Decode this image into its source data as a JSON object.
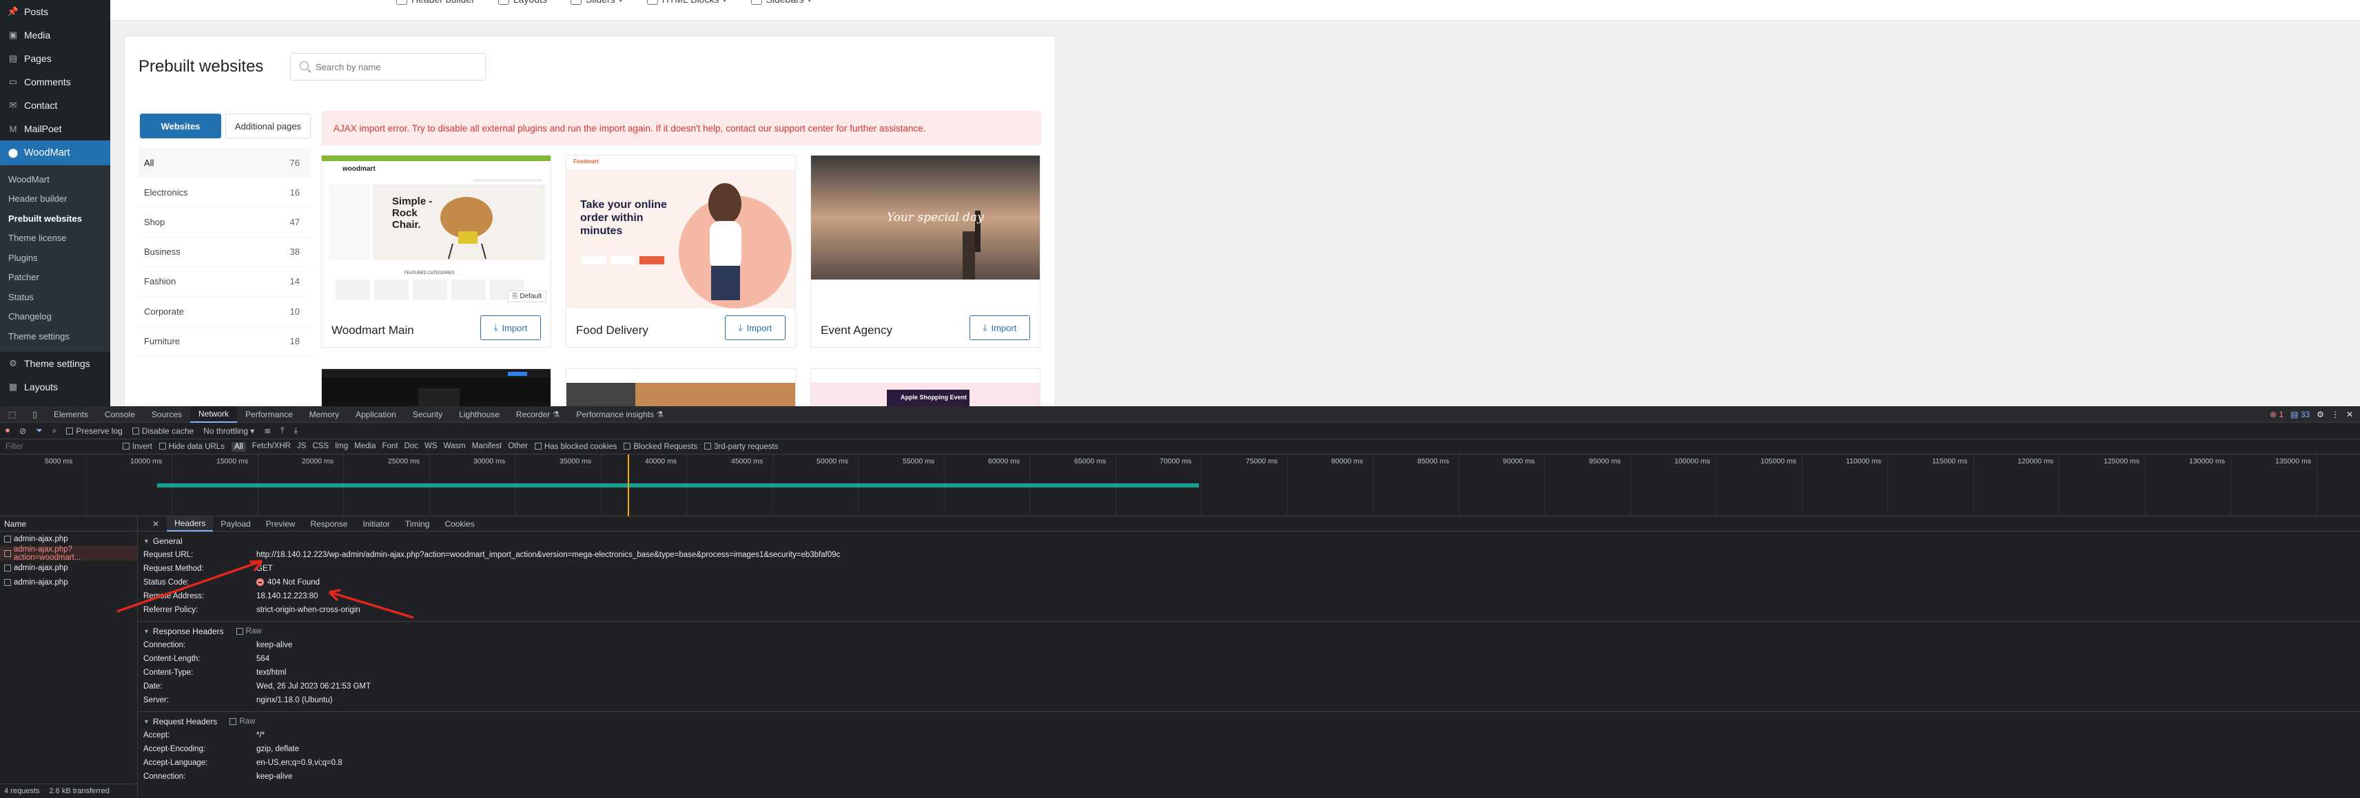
{
  "wp_sidebar": {
    "items_before": [
      {
        "label": "Posts",
        "icon": "pin-icon"
      },
      {
        "label": "Media",
        "icon": "media-icon"
      },
      {
        "label": "Pages",
        "icon": "pages-icon"
      },
      {
        "label": "Comments",
        "icon": "comments-icon"
      },
      {
        "label": "Contact",
        "icon": "mail-icon"
      },
      {
        "label": "MailPoet",
        "icon": "mailpoet-icon"
      }
    ],
    "current": "WoodMart",
    "subitems": [
      "WoodMart",
      "Header builder",
      "Prebuilt websites",
      "Theme license",
      "Plugins",
      "Patcher",
      "Status",
      "Changelog",
      "Theme settings"
    ],
    "items_after": [
      {
        "label": "Theme settings",
        "icon": "settings-icon"
      },
      {
        "label": "Layouts",
        "icon": "layouts-icon"
      }
    ]
  },
  "top_nav": [
    "Header builder",
    "Layouts",
    "Sliders ˅",
    "HTML Blocks ˅",
    "Sidebars ˅"
  ],
  "panel": {
    "title": "Prebuilt websites",
    "search_placeholder": "Search by name",
    "tab_websites": "Websites",
    "tab_additional": "Additional pages",
    "error": "AJAX import error. Try to disable all external plugins and run the import again. If it doesn't help, contact our support center for further assistance.",
    "categories": [
      {
        "name": "All",
        "count": "76"
      },
      {
        "name": "Electronics",
        "count": "16"
      },
      {
        "name": "Shop",
        "count": "47"
      },
      {
        "name": "Business",
        "count": "38"
      },
      {
        "name": "Fashion",
        "count": "14"
      },
      {
        "name": "Corporate",
        "count": "10"
      },
      {
        "name": "Furniture",
        "count": "18"
      }
    ],
    "cards": [
      {
        "name": "Woodmart Main",
        "import": "Import",
        "badge": "Default",
        "logo": "woodmart",
        "headline": "Simple - Rock Chair.",
        "sub": "FEATURED CATEGORIES"
      },
      {
        "name": "Food Delivery",
        "import": "Import",
        "logo": "Foodmart",
        "headline": "Take your online order within minutes"
      },
      {
        "name": "Event Agency",
        "import": "Import",
        "headline": "Your special day"
      }
    ],
    "row2_tiles": [
      {
        "caption": ""
      },
      {
        "caption": ""
      },
      {
        "caption": "Apple Shopping Event"
      }
    ]
  },
  "devtools": {
    "tabs": [
      "Elements",
      "Console",
      "Sources",
      "Network",
      "Performance",
      "Memory",
      "Application",
      "Security",
      "Lighthouse",
      "Recorder ⚗",
      "Performance insights ⚗"
    ],
    "active_tab": "Network",
    "badges": {
      "errors": "1",
      "messages": "33"
    },
    "toolbar": {
      "preserve_log": "Preserve log",
      "disable_cache": "Disable cache",
      "throttling": "No throttling"
    },
    "filter": {
      "placeholder": "Filter",
      "invert": "Invert",
      "hide_data_urls": "Hide data URLs",
      "types": [
        "All",
        "Fetch/XHR",
        "JS",
        "CSS",
        "Img",
        "Media",
        "Font",
        "Doc",
        "WS",
        "Wasm",
        "Manifest",
        "Other"
      ],
      "blocked_cookies": "Has blocked cookies",
      "blocked_requests": "Blocked Requests",
      "third_party": "3rd-party requests"
    },
    "timeline_ticks": [
      "5000 ms",
      "10000 ms",
      "15000 ms",
      "20000 ms",
      "25000 ms",
      "30000 ms",
      "35000 ms",
      "40000 ms",
      "45000 ms",
      "50000 ms",
      "55000 ms",
      "60000 ms",
      "65000 ms",
      "70000 ms",
      "75000 ms",
      "80000 ms",
      "85000 ms",
      "90000 ms",
      "95000 ms",
      "100000 ms",
      "105000 ms",
      "110000 ms",
      "115000 ms",
      "120000 ms",
      "125000 ms",
      "130000 ms",
      "135000 ms"
    ],
    "name_header": "Name",
    "requests": [
      "admin-ajax.php",
      "admin-ajax.php?action=woodmart...",
      "admin-ajax.php",
      "admin-ajax.php"
    ],
    "status_bar": {
      "requests": "4 requests",
      "transferred": "2.6 kB transferred"
    },
    "detail_tabs": [
      "Headers",
      "Payload",
      "Preview",
      "Response",
      "Initiator",
      "Timing",
      "Cookies"
    ],
    "general": {
      "title": "General",
      "rows": [
        {
          "k": "Request URL:",
          "v": "http://18.140.12.223/wp-admin/admin-ajax.php?action=woodmart_import_action&version=mega-electronics_base&type=base&process=images1&security=eb3bfaf09c"
        },
        {
          "k": "Request Method:",
          "v": "GET"
        },
        {
          "k": "Status Code:",
          "v": "404 Not Found"
        },
        {
          "k": "Remote Address:",
          "v": "18.140.12.223:80"
        },
        {
          "k": "Referrer Policy:",
          "v": "strict-origin-when-cross-origin"
        }
      ]
    },
    "response_headers": {
      "title": "Response Headers",
      "raw": "Raw",
      "rows": [
        {
          "k": "Connection:",
          "v": "keep-alive"
        },
        {
          "k": "Content-Length:",
          "v": "564"
        },
        {
          "k": "Content-Type:",
          "v": "text/html"
        },
        {
          "k": "Date:",
          "v": "Wed, 26 Jul 2023 06:21:53 GMT"
        },
        {
          "k": "Server:",
          "v": "nginx/1.18.0 (Ubuntu)"
        }
      ]
    },
    "request_headers": {
      "title": "Request Headers",
      "raw": "Raw",
      "rows": [
        {
          "k": "Accept:",
          "v": "*/*"
        },
        {
          "k": "Accept-Encoding:",
          "v": "gzip, deflate"
        },
        {
          "k": "Accept-Language:",
          "v": "en-US,en;q=0.9,vi;q=0.8"
        },
        {
          "k": "Connection:",
          "v": "keep-alive"
        }
      ]
    }
  },
  "colors": {
    "wp_dark": "#1d2327",
    "wp_blue": "#2271b1",
    "error_red": "#d63638",
    "annotation_red": "#e0281f"
  }
}
